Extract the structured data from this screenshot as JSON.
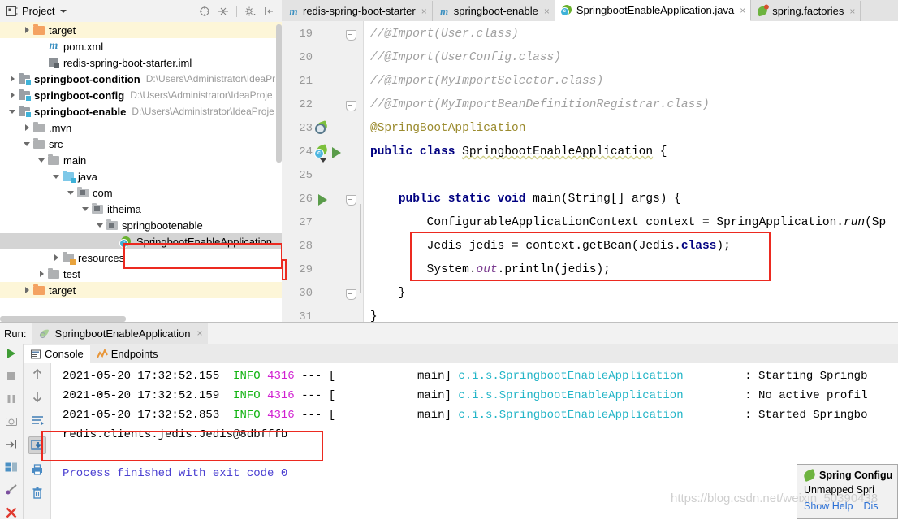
{
  "project_panel": {
    "title": "Project",
    "icons": [
      "project-view-icon",
      "chevron-down-icon",
      "locate-icon",
      "collapse-all-icon",
      "settings-gear-icon",
      "hide-panel-icon"
    ],
    "tree": [
      {
        "label": "target",
        "path": "",
        "indent": 1,
        "arrow": "right",
        "icon": "folder-orange",
        "state": "highlight"
      },
      {
        "label": "pom.xml",
        "path": "",
        "indent": 2,
        "arrow": "none",
        "icon": "maven-m",
        "state": "normal"
      },
      {
        "label": "redis-spring-boot-starter.iml",
        "path": "",
        "indent": 2,
        "arrow": "none",
        "icon": "iml-file",
        "state": "normal"
      },
      {
        "label": "springboot-condition",
        "path": "D:\\Users\\Administrator\\IdeaPr",
        "indent": 0,
        "arrow": "right",
        "icon": "module-folder",
        "state": "bold"
      },
      {
        "label": "springboot-config",
        "path": "D:\\Users\\Administrator\\IdeaProje",
        "indent": 0,
        "arrow": "right",
        "icon": "module-folder",
        "state": "bold"
      },
      {
        "label": "springboot-enable",
        "path": "D:\\Users\\Administrator\\IdeaProje",
        "indent": 0,
        "arrow": "down",
        "icon": "module-folder",
        "state": "bold"
      },
      {
        "label": ".mvn",
        "path": "",
        "indent": 1,
        "arrow": "right",
        "icon": "folder-gray",
        "state": "normal"
      },
      {
        "label": "src",
        "path": "",
        "indent": 1,
        "arrow": "down",
        "icon": "folder-gray",
        "state": "normal"
      },
      {
        "label": "main",
        "path": "",
        "indent": 2,
        "arrow": "down",
        "icon": "folder-gray",
        "state": "normal"
      },
      {
        "label": "java",
        "path": "",
        "indent": 3,
        "arrow": "down",
        "icon": "folder-source",
        "state": "normal"
      },
      {
        "label": "com",
        "path": "",
        "indent": 4,
        "arrow": "down",
        "icon": "folder-package",
        "state": "normal"
      },
      {
        "label": "itheima",
        "path": "",
        "indent": 5,
        "arrow": "down",
        "icon": "folder-package",
        "state": "normal"
      },
      {
        "label": "springbootenable",
        "path": "",
        "indent": 6,
        "arrow": "down",
        "icon": "folder-package",
        "state": "normal"
      },
      {
        "label": "SpringbootEnableApplication",
        "path": "",
        "indent": 7,
        "arrow": "none",
        "icon": "spring-class",
        "state": "selected"
      },
      {
        "label": "resources",
        "path": "",
        "indent": 3,
        "arrow": "right",
        "icon": "folder-resources",
        "state": "normal"
      },
      {
        "label": "test",
        "path": "",
        "indent": 2,
        "arrow": "right",
        "icon": "folder-gray",
        "state": "normal"
      },
      {
        "label": "target",
        "path": "",
        "indent": 1,
        "arrow": "right",
        "icon": "folder-orange",
        "state": "highlight"
      }
    ]
  },
  "editor": {
    "tabs": [
      {
        "label": "redis-spring-boot-starter",
        "icon": "maven-m-icon",
        "active": false
      },
      {
        "label": "springboot-enable",
        "icon": "maven-m-icon",
        "active": false
      },
      {
        "label": "SpringbootEnableApplication.java",
        "icon": "spring-class-icon",
        "active": true
      },
      {
        "label": "spring.factories",
        "icon": "spring-factories-icon",
        "active": false
      }
    ],
    "close_glyph": "×",
    "lines": [
      {
        "n": "19",
        "gutter": "fold-collapsed",
        "marker": "",
        "code_html": "<span class=\"cm\">//@Import(User.class)</span>"
      },
      {
        "n": "20",
        "gutter": "",
        "marker": "",
        "code_html": "<span class=\"cm\">//@Import(UserConfig.class)</span>"
      },
      {
        "n": "21",
        "gutter": "",
        "marker": "",
        "code_html": "<span class=\"cm\">//@Import(MyImportSelector.class)</span>"
      },
      {
        "n": "22",
        "gutter": "fold-collapsed",
        "marker": "",
        "code_html": "<span class=\"cm\">//@Import(MyImportBeanDefinitionRegistrar.class)</span>"
      },
      {
        "n": "23",
        "gutter": "bean-search",
        "marker": "",
        "code_html": "<span class=\"an\">@SpringBootApplication</span>"
      },
      {
        "n": "24",
        "gutter": "bean-config-run",
        "marker": "",
        "code_html": "<span class=\"k\">public class</span> <span class=\"squiggle\">SpringbootEnableApplication</span> {"
      },
      {
        "n": "25",
        "gutter": "",
        "marker": "",
        "code_html": ""
      },
      {
        "n": "26",
        "gutter": "run-fold",
        "marker": "",
        "code_html": "    <span class=\"k\">public static void</span> main(String[] args) {"
      },
      {
        "n": "27",
        "gutter": "",
        "marker": "",
        "code_html": "        ConfigurableApplicationContext context = SpringApplication.<span class=\"it\">run</span>(Sp"
      },
      {
        "n": "28",
        "gutter": "",
        "marker": "",
        "code_html": "        Jedis jedis = context.getBean(Jedis.<span class=\"k\">class</span>);"
      },
      {
        "n": "29",
        "gutter": "",
        "marker": "edge",
        "code_html": "        System.<span class=\"it-p\">out</span>.println(jedis);"
      },
      {
        "n": "30",
        "gutter": "fold-collapsed",
        "marker": "",
        "code_html": "    }"
      },
      {
        "n": "31",
        "gutter": "",
        "marker": "",
        "code_html": "}"
      }
    ],
    "annotation_box": "red-highlight-jedis-lines"
  },
  "run_panel": {
    "run_label": "Run:",
    "config_name": "SpringbootEnableApplication",
    "close_glyph": "×",
    "subtabs": [
      {
        "label": "Console",
        "icon": "console-icon",
        "active": true
      },
      {
        "label": "Endpoints",
        "icon": "endpoints-icon",
        "active": false
      }
    ],
    "left_rail_icons": [
      "rerun-icon",
      "stop-icon",
      "pause-icon",
      "camera-icon",
      "resume-icon",
      "layout-icon",
      "settings-pin-icon",
      "close-icon"
    ],
    "console_rail_icons": [
      "scroll-up-icon",
      "scroll-down-icon",
      "soft-wrap-icon",
      "scroll-to-end-icon",
      "print-icon",
      "clear-all-icon"
    ],
    "console_lines": [
      {
        "type": "log",
        "timestamp": "2021-05-20 17:32:52.155",
        "level": "INFO",
        "pid": "4316",
        "sep": "---",
        "bracket": "[",
        "thread": "main]",
        "logger": "c.i.s.SpringbootEnableApplication",
        "colon": ":",
        "message": "Starting Springb"
      },
      {
        "type": "log",
        "timestamp": "2021-05-20 17:32:52.159",
        "level": "INFO",
        "pid": "4316",
        "sep": "---",
        "bracket": "[",
        "thread": "main]",
        "logger": "c.i.s.SpringbootEnableApplication",
        "colon": ":",
        "message": "No active profil"
      },
      {
        "type": "log",
        "timestamp": "2021-05-20 17:32:52.853",
        "level": "INFO",
        "pid": "4316",
        "sep": "---",
        "bracket": "[",
        "thread": "main]",
        "logger": "c.i.s.SpringbootEnableApplication",
        "colon": ":",
        "message": "Started Springbo"
      },
      {
        "type": "plain",
        "text": "redis.clients.jedis.Jedis@8dbfffb"
      },
      {
        "type": "blank",
        "text": ""
      },
      {
        "type": "exit",
        "text": "Process finished with exit code 0"
      }
    ],
    "annotation_box": "red-highlight-jedis-output"
  },
  "spring_popup": {
    "title": "Spring Configu",
    "body": "Unmapped Spri",
    "links": [
      "Show Help",
      "Dis"
    ],
    "icon": "spring-leaf-icon"
  },
  "watermark": "https://blog.csdn.net/weixin_50390438",
  "colors": {
    "accent_red": "#ec2a20",
    "spring_green": "#6db33f",
    "keyword_blue": "#000080",
    "annotation_yellow": "#9b8b2e",
    "info_green": "#12b312",
    "pid_magenta": "#d11fd1",
    "logger_cyan": "#23b5c7",
    "exit_purple": "#4a3fd1",
    "folder_orange": "#f4a261",
    "selected_row": "#d4d4d4",
    "highlight_row": "#fdf6d8"
  }
}
